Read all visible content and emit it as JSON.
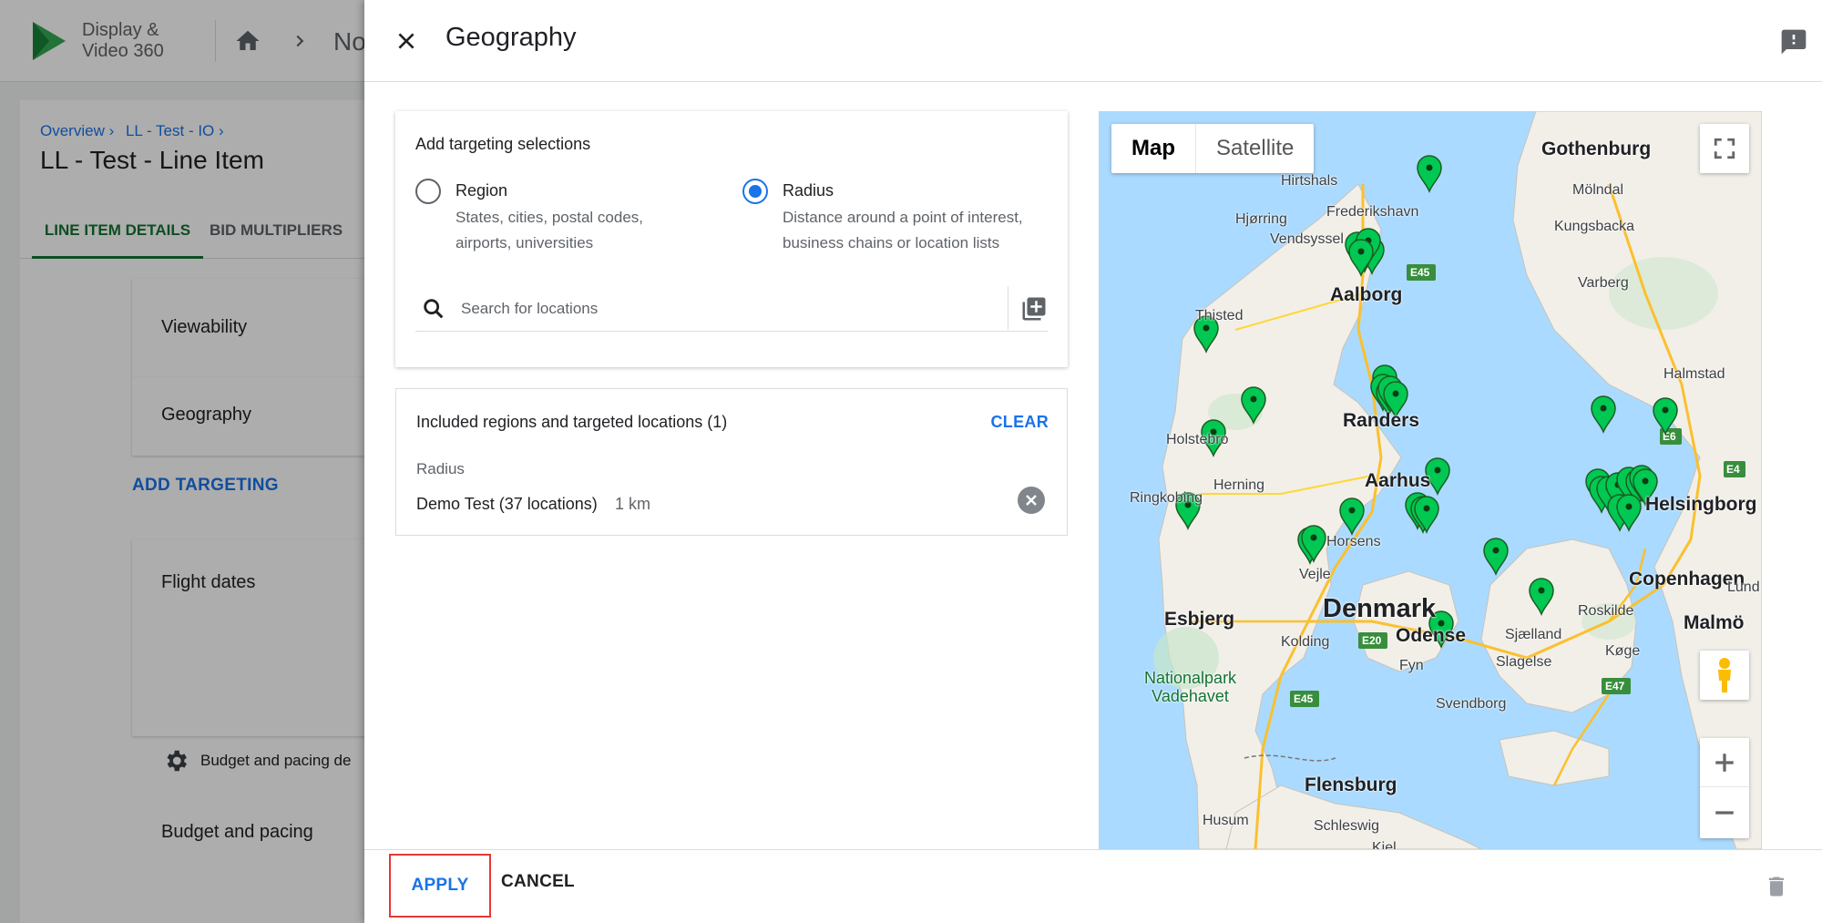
{
  "app": {
    "name_line1": "Display &",
    "name_line2": "Video 360",
    "topbar_crumb": "No"
  },
  "background": {
    "breadcrumbs": [
      "Overview ›",
      "LL - Test - IO ›"
    ],
    "line_item_title": "LL - Test - Line Item",
    "tabs": [
      {
        "label": "LINE ITEM DETAILS",
        "active": true
      },
      {
        "label": "BID MULTIPLIERS",
        "active": false
      }
    ],
    "sections": {
      "viewability": "Viewability",
      "geography": "Geography",
      "add_targeting": "ADD TARGETING",
      "flight_dates": "Flight dates",
      "budget_pacing_details": "Budget and pacing de",
      "budget_pacing": "Budget and pacing"
    }
  },
  "panel": {
    "title": "Geography",
    "targeting": {
      "heading": "Add targeting selections",
      "options": [
        {
          "label": "Region",
          "desc_line1": "States, cities, postal codes,",
          "desc_line2": "airports, universities",
          "checked": false
        },
        {
          "label": "Radius",
          "desc_line1": "Distance around a point of interest,",
          "desc_line2": "business chains or location lists",
          "checked": true
        }
      ],
      "search_placeholder": "Search for locations"
    },
    "included": {
      "title": "Included regions and targeted locations (1)",
      "clear_label": "CLEAR",
      "type_label": "Radius",
      "item_name": "Demo Test (37 locations)",
      "item_radius": "1 km"
    },
    "map": {
      "type_options": [
        "Map",
        "Satellite"
      ],
      "selected_type": "Map",
      "labels": {
        "gothenburg": "Gothenburg",
        "molndal": "Mölndal",
        "kungsbacka": "Kungsbacka",
        "varberg": "Varberg",
        "halmstad": "Halmstad",
        "hirtshals": "Hirtshals",
        "hjorring": "Hjørring",
        "frederikshavn": "Frederikshavn",
        "vendsyssel": "Vendsyssel",
        "aalborg": "Aalborg",
        "thisted": "Thisted",
        "randers": "Randers",
        "holstebro": "Holstebro",
        "herning": "Herning",
        "aarhus": "Aarhus",
        "ringkobing": "Ringkobing",
        "horsens": "Horsens",
        "vejle": "Vejle",
        "denmark": "Denmark",
        "odense": "Odense",
        "esbjerg": "Esbjerg",
        "kolding": "Kolding",
        "fyn": "Fyn",
        "sjaelland": "Sjælland",
        "roskilde": "Roskilde",
        "koge": "Køge",
        "helsingborg": "Helsingborg",
        "copenhagen": "Copenhagen",
        "malmo": "Malmö",
        "lund": "Lund",
        "slagelse": "Slagelse",
        "svendborg": "Svendborg",
        "park_line1": "Nationalpark",
        "park_line2": "Vadehavet",
        "flensburg": "Flensburg",
        "husum": "Husum",
        "schleswig": "Schleswig",
        "kiel": "Kiel"
      },
      "road_shields": [
        "E45",
        "E6",
        "E4",
        "E20",
        "E47",
        "E45"
      ]
    },
    "footer": {
      "apply_label": "APPLY",
      "cancel_label": "CANCEL"
    }
  },
  "colors": {
    "accent": "#1a73e8",
    "active_tab": "#137333",
    "pin": "#00c853",
    "highlight_box": "#e53935",
    "water": "#aadaff",
    "land": "#f2efe9"
  },
  "icons": [
    "logo-icon",
    "home-icon",
    "chevron-right-icon",
    "close-icon",
    "feedback-icon",
    "search-icon",
    "bulk-add-icon",
    "clear-circle-icon",
    "fullscreen-icon",
    "pegman-icon",
    "plus-icon",
    "minus-icon",
    "gear-icon",
    "trash-icon",
    "map-pin-icon"
  ]
}
